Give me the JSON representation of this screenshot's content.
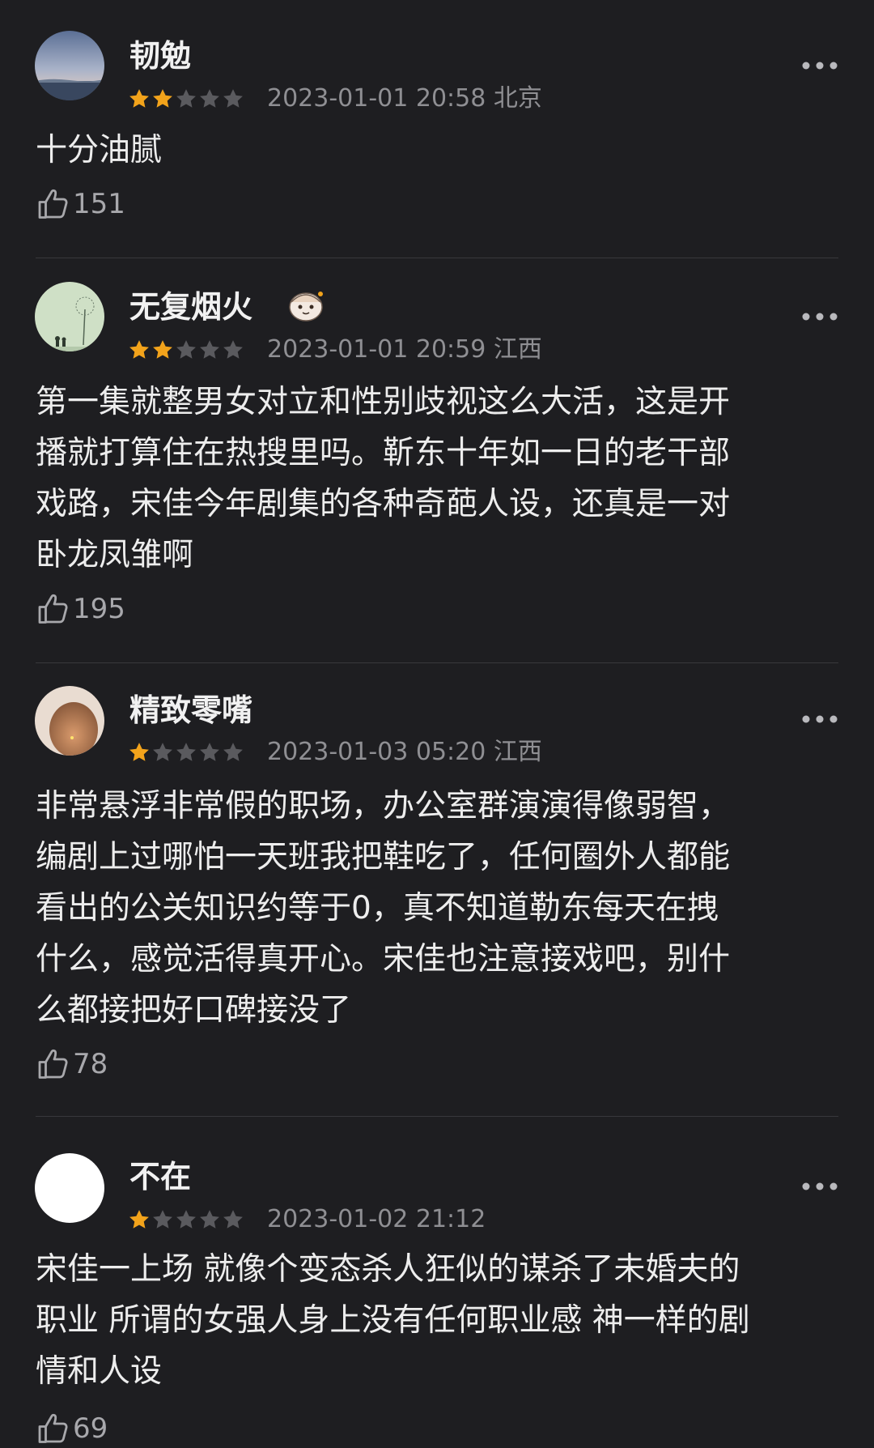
{
  "colors": {
    "background": "#1e1e21",
    "star_filled": "#f2a31b",
    "star_empty": "#5a5a5e",
    "meta_text": "#8f8f93",
    "divider": "#38383c"
  },
  "icons": {
    "more": "more-dots-icon",
    "like": "thumbs-up-icon",
    "star": "star-icon"
  },
  "reviews": [
    {
      "username": "韧勉",
      "rating": 2,
      "rating_max": 5,
      "datetime": "2023-01-01 20:58",
      "location": "北京",
      "meta": "2023-01-01 20:58 北京",
      "content": "十分油腻",
      "likes": "151"
    },
    {
      "username": "无复烟火",
      "rating": 2,
      "rating_max": 5,
      "datetime": "2023-01-01 20:59",
      "location": "江西",
      "meta": "2023-01-01 20:59 江西",
      "content": "第一集就整男女对立和性别歧视这么大活，这是开\n播就打算住在热搜里吗。靳东十年如一日的老干部\n戏路，宋佳今年剧集的各种奇葩人设，还真是一对\n卧龙凤雏啊",
      "likes": "195"
    },
    {
      "username": "精致零嘴",
      "rating": 1,
      "rating_max": 5,
      "datetime": "2023-01-03 05:20",
      "location": "江西",
      "meta": "2023-01-03 05:20 江西",
      "content": "非常悬浮非常假的职场，办公室群演演得像弱智，\n编剧上过哪怕一天班我把鞋吃了，任何圈外人都能\n看出的公关知识约等于0，真不知道勒东每天在拽\n什么，感觉活得真开心。宋佳也注意接戏吧，别什\n么都接把好口碑接没了",
      "likes": "78"
    },
    {
      "username": "不在",
      "rating": 1,
      "rating_max": 5,
      "datetime": "2023-01-02 21:12",
      "location": "",
      "meta": "2023-01-02 21:12",
      "content": "宋佳一上场 就像个变态杀人狂似的谋杀了未婚夫的\n职业 所谓的女强人身上没有任何职业感 神一样的剧\n情和人设",
      "likes": "69"
    }
  ]
}
